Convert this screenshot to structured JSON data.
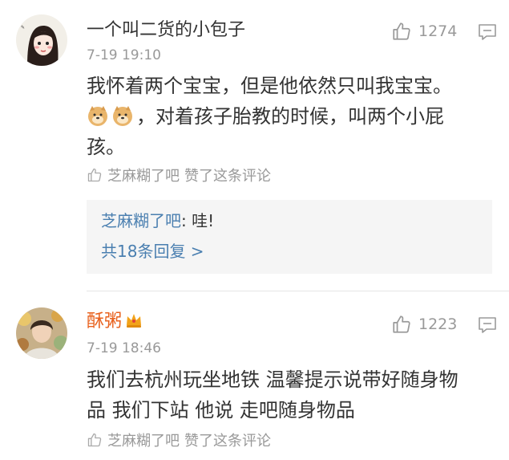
{
  "comments": [
    {
      "username": "一个叫二货的小包子",
      "time": "7-19 19:10",
      "likes": "1274",
      "text_line1": "我怀着两个宝宝，但是他依然只叫我宝宝。",
      "text_line2": "，对着孩子胎教的时候，叫两个小屁",
      "text_line3": "孩。",
      "emoji": "doge-emoji",
      "liked_by": "芝麻糊了吧",
      "liked_suffix": "赞了这条评论",
      "reply_author": "芝麻糊了吧",
      "reply_text": ": 哇!",
      "reply_count_label": "共18条回复 >"
    },
    {
      "username": "酥粥",
      "vip_badge": "crown-icon",
      "time": "7-19 18:46",
      "likes": "1223",
      "text_line1": "我们去杭州玩坐地铁 温馨提示说带好随身物",
      "text_line2": "品 我们下站 他说 走吧随身物品",
      "liked_by": "芝麻糊了吧",
      "liked_suffix": "赞了这条评论"
    }
  ],
  "colors": {
    "link": "#4a7fb0",
    "meta": "#999999",
    "text": "#333333",
    "reply_bg": "#f5f5f5"
  }
}
